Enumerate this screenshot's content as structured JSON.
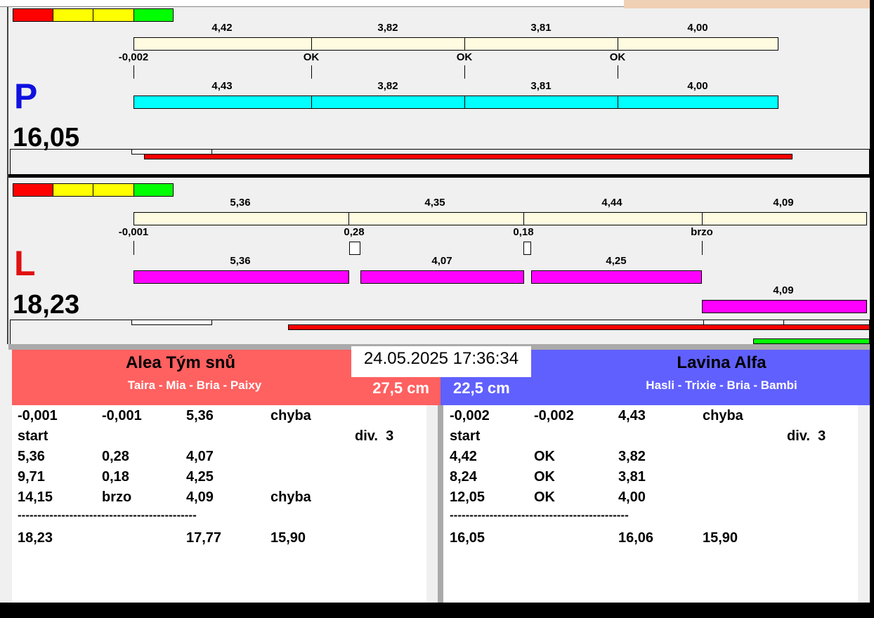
{
  "lanes": {
    "P": {
      "letter": "P",
      "total": "16,05",
      "color": "#1010e0",
      "top_labels": [
        "4,42",
        "3,82",
        "3,81",
        "4,00"
      ],
      "mid_labels": [
        "-0,002",
        "OK",
        "OK",
        "OK"
      ],
      "bottom_labels": [
        "4,43",
        "3,82",
        "3,81",
        "4,00"
      ]
    },
    "L": {
      "letter": "L",
      "total": "18,23",
      "color": "#e01010",
      "top_labels": [
        "5,36",
        "4,35",
        "4,44",
        "4,09"
      ],
      "mid_labels": [
        "-0,001",
        "0,28",
        "0,18",
        "brzo"
      ],
      "bottom_labels": [
        "5,36",
        "4,07",
        "4,25",
        "4,09"
      ]
    }
  },
  "datetime": "24.05.2025 17:36:34",
  "teams": {
    "left": {
      "name": "Alea Tým snů",
      "dogs": "Taira - Mia - Bria - Paixy",
      "height": "27,5 cm",
      "color": "#ff6060",
      "rows": [
        [
          "-0,001",
          "-0,001",
          "5,36",
          "chyba"
        ],
        [
          "start",
          "",
          "",
          "",
          "div.  3"
        ],
        [
          "5,36",
          "0,28",
          "4,07",
          ""
        ],
        [
          "9,71",
          "0,18",
          "4,25",
          ""
        ],
        [
          "14,15",
          "brzo",
          "4,09",
          "chyba"
        ]
      ],
      "divider": "---------------------------------------------",
      "totals": [
        "18,23",
        "",
        "17,77",
        "15,90"
      ]
    },
    "right": {
      "name": "Lavina Alfa",
      "dogs": "Hasli - Trixie - Bria - Bambi",
      "height": "22,5 cm",
      "color": "#6060ff",
      "rows": [
        [
          "-0,002",
          "-0,002",
          "4,43",
          "chyba"
        ],
        [
          "start",
          "",
          "",
          "",
          "div.  3"
        ],
        [
          "4,42",
          "OK",
          "3,82",
          ""
        ],
        [
          "8,24",
          "OK",
          "3,81",
          ""
        ],
        [
          "12,05",
          "OK",
          "4,00",
          ""
        ]
      ],
      "divider": "---------------------------------------------",
      "totals": [
        "16,05",
        "",
        "16,06",
        "15,90"
      ]
    }
  }
}
